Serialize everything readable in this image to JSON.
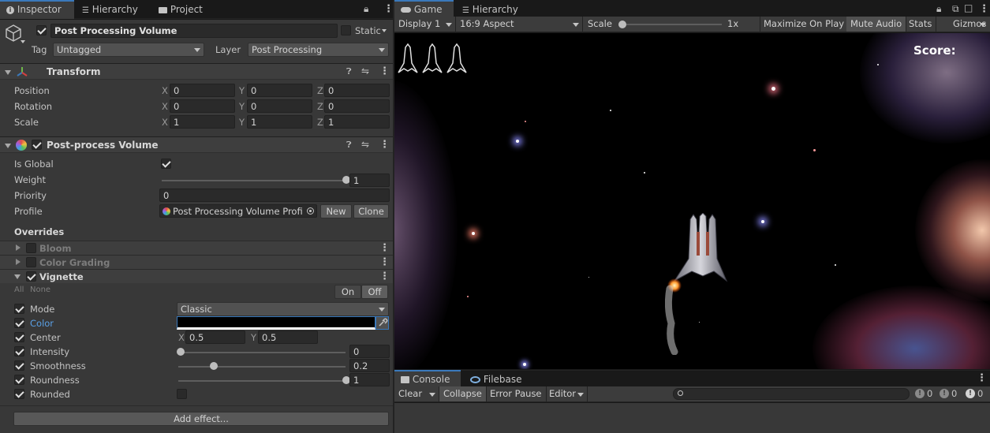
{
  "inspector_tabs": [
    {
      "label": "Inspector",
      "icon": "info-icon"
    },
    {
      "label": "Hierarchy",
      "icon": "list-icon"
    },
    {
      "label": "Project",
      "icon": "folder-icon"
    }
  ],
  "game_tabs": [
    {
      "label": "Game",
      "icon": "gamepad-icon"
    },
    {
      "label": "Hierarchy",
      "icon": "list-icon"
    }
  ],
  "object": {
    "name": "Post Processing Volume",
    "active": true,
    "static_label": "Static",
    "tag_label": "Tag",
    "tag_value": "Untagged",
    "layer_label": "Layer",
    "layer_value": "Post Processing"
  },
  "transform": {
    "title": "Transform",
    "rows": [
      {
        "label": "Position",
        "x": "0",
        "y": "0",
        "z": "0"
      },
      {
        "label": "Rotation",
        "x": "0",
        "y": "0",
        "z": "0"
      },
      {
        "label": "Scale",
        "x": "1",
        "y": "1",
        "z": "1"
      }
    ]
  },
  "volume": {
    "title": "Post-process Volume",
    "is_global_label": "Is Global",
    "is_global": true,
    "weight_label": "Weight",
    "weight_value": "1",
    "weight_fraction": 1.0,
    "priority_label": "Priority",
    "priority_value": "0",
    "profile_label": "Profile",
    "profile_value": "Post Processing Volume Profi",
    "new_label": "New",
    "clone_label": "Clone"
  },
  "overrides": {
    "title": "Overrides",
    "effects": [
      {
        "name": "Bloom",
        "enabled": false,
        "expanded": false
      },
      {
        "name": "Color Grading",
        "enabled": false,
        "expanded": false
      },
      {
        "name": "Vignette",
        "enabled": true,
        "expanded": true
      }
    ],
    "all_label": "All",
    "none_label": "None",
    "on_label": "On",
    "off_label": "Off"
  },
  "vignette": {
    "mode_label": "Mode",
    "mode_value": "Classic",
    "color_label": "Color",
    "color_value": "#000000",
    "center_label": "Center",
    "center_x": "0.5",
    "center_y": "0.5",
    "intensity_label": "Intensity",
    "intensity_value": "0",
    "intensity_fraction": 0.0,
    "smoothness_label": "Smoothness",
    "smoothness_value": "0.2",
    "smoothness_fraction": 0.2,
    "roundness_label": "Roundness",
    "roundness_value": "1",
    "roundness_fraction": 1.0,
    "rounded_label": "Rounded",
    "rounded": false
  },
  "add_effect_label": "Add effect...",
  "game_toolbar": {
    "display": "Display 1",
    "aspect": "16:9 Aspect",
    "scale_label": "Scale",
    "scale_value": "1x",
    "maximize": "Maximize On Play",
    "mute": "Mute Audio",
    "stats": "Stats",
    "gizmos": "Gizmos"
  },
  "game_view": {
    "score_label": "Score:",
    "lives": 3
  },
  "console": {
    "tabs": [
      {
        "label": "Console",
        "icon": "console-icon"
      },
      {
        "label": "Filebase",
        "icon": "filebase-icon"
      }
    ],
    "clear": "Clear",
    "collapse": "Collapse",
    "error_pause": "Error Pause",
    "editor": "Editor",
    "search_placeholder": "",
    "log_count": "0",
    "warning_count": "0",
    "error_count": "0"
  },
  "colors": {
    "accent": "#3a79bb",
    "panel": "#383838",
    "background": "#191919"
  }
}
